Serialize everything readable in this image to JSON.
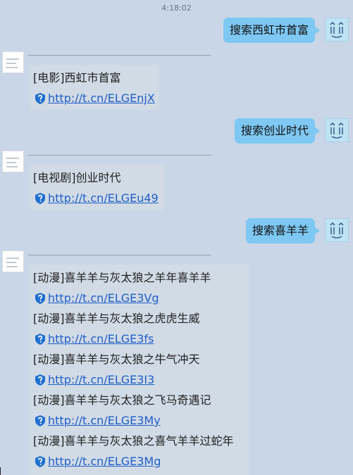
{
  "timestamp": "4:18:02",
  "conversation": [
    {
      "query": "搜索西虹市首富",
      "results": [
        {
          "title": "[电影]西虹市首富",
          "link": "http://t.cn/ELGEnjX"
        }
      ]
    },
    {
      "query": "搜索创业时代",
      "results": [
        {
          "title": "[电视剧]创业时代",
          "link": "http://t.cn/ELGEu49"
        }
      ]
    },
    {
      "query": "搜索喜羊羊",
      "results": [
        {
          "title": "[动漫]喜羊羊与灰太狼之羊年喜羊羊",
          "link": "http://t.cn/ELGE3Vg"
        },
        {
          "title": "[动漫]喜羊羊与灰太狼之虎虎生威",
          "link": "http://t.cn/ELGE3fs"
        },
        {
          "title": "[动漫]喜羊羊与灰太狼之牛气冲天",
          "link": "http://t.cn/ELGE3I3"
        },
        {
          "title": "[动漫]喜羊羊与灰太狼之飞马奇遇记",
          "link": "http://t.cn/ELGE3My"
        },
        {
          "title": "[动漫]喜羊羊与灰太狼之喜气羊羊过蛇年",
          "link": "http://t.cn/ELGE3Mg"
        }
      ]
    }
  ],
  "icons": {
    "user_avatar": "cartoon-face-icon",
    "bot_avatar": "document-thumbnail-icon",
    "link_badge": "shield-question-icon"
  },
  "colors": {
    "background": "#c9d6e7",
    "user_bubble": "#7ec8f3",
    "bot_bubble": "#d1dbe6",
    "link": "#1f5ec8",
    "shield": "#1f6fd0"
  }
}
